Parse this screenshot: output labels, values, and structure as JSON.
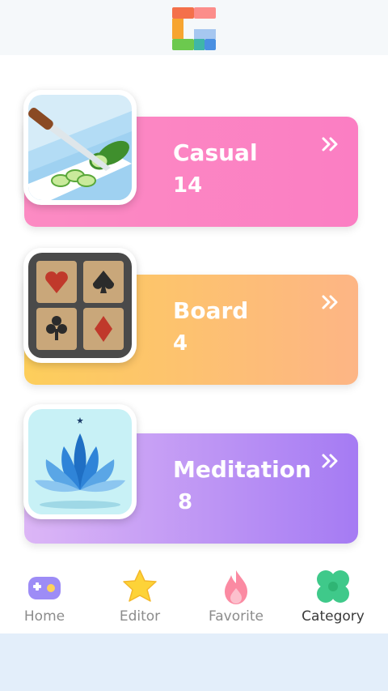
{
  "categories": [
    {
      "name": "Casual",
      "count": "14",
      "icon": "cucumber-slicing-icon"
    },
    {
      "name": "Board",
      "count": "4",
      "icon": "card-suits-icon"
    },
    {
      "name": "Meditation",
      "count": "8",
      "icon": "lotus-icon"
    }
  ],
  "nav": {
    "items": [
      {
        "label": "Home",
        "icon": "gamepad-icon"
      },
      {
        "label": "Editor",
        "icon": "star-icon"
      },
      {
        "label": "Favorite",
        "icon": "flame-icon"
      },
      {
        "label": "Category",
        "icon": "clover-icon",
        "active": true
      }
    ]
  },
  "colors": {
    "casual": "#fb7ec3",
    "board": "#fdc068",
    "meditation": "#b48cf5",
    "nav_active": "#3a3a3a",
    "nav_inactive": "#8c8c8c"
  }
}
